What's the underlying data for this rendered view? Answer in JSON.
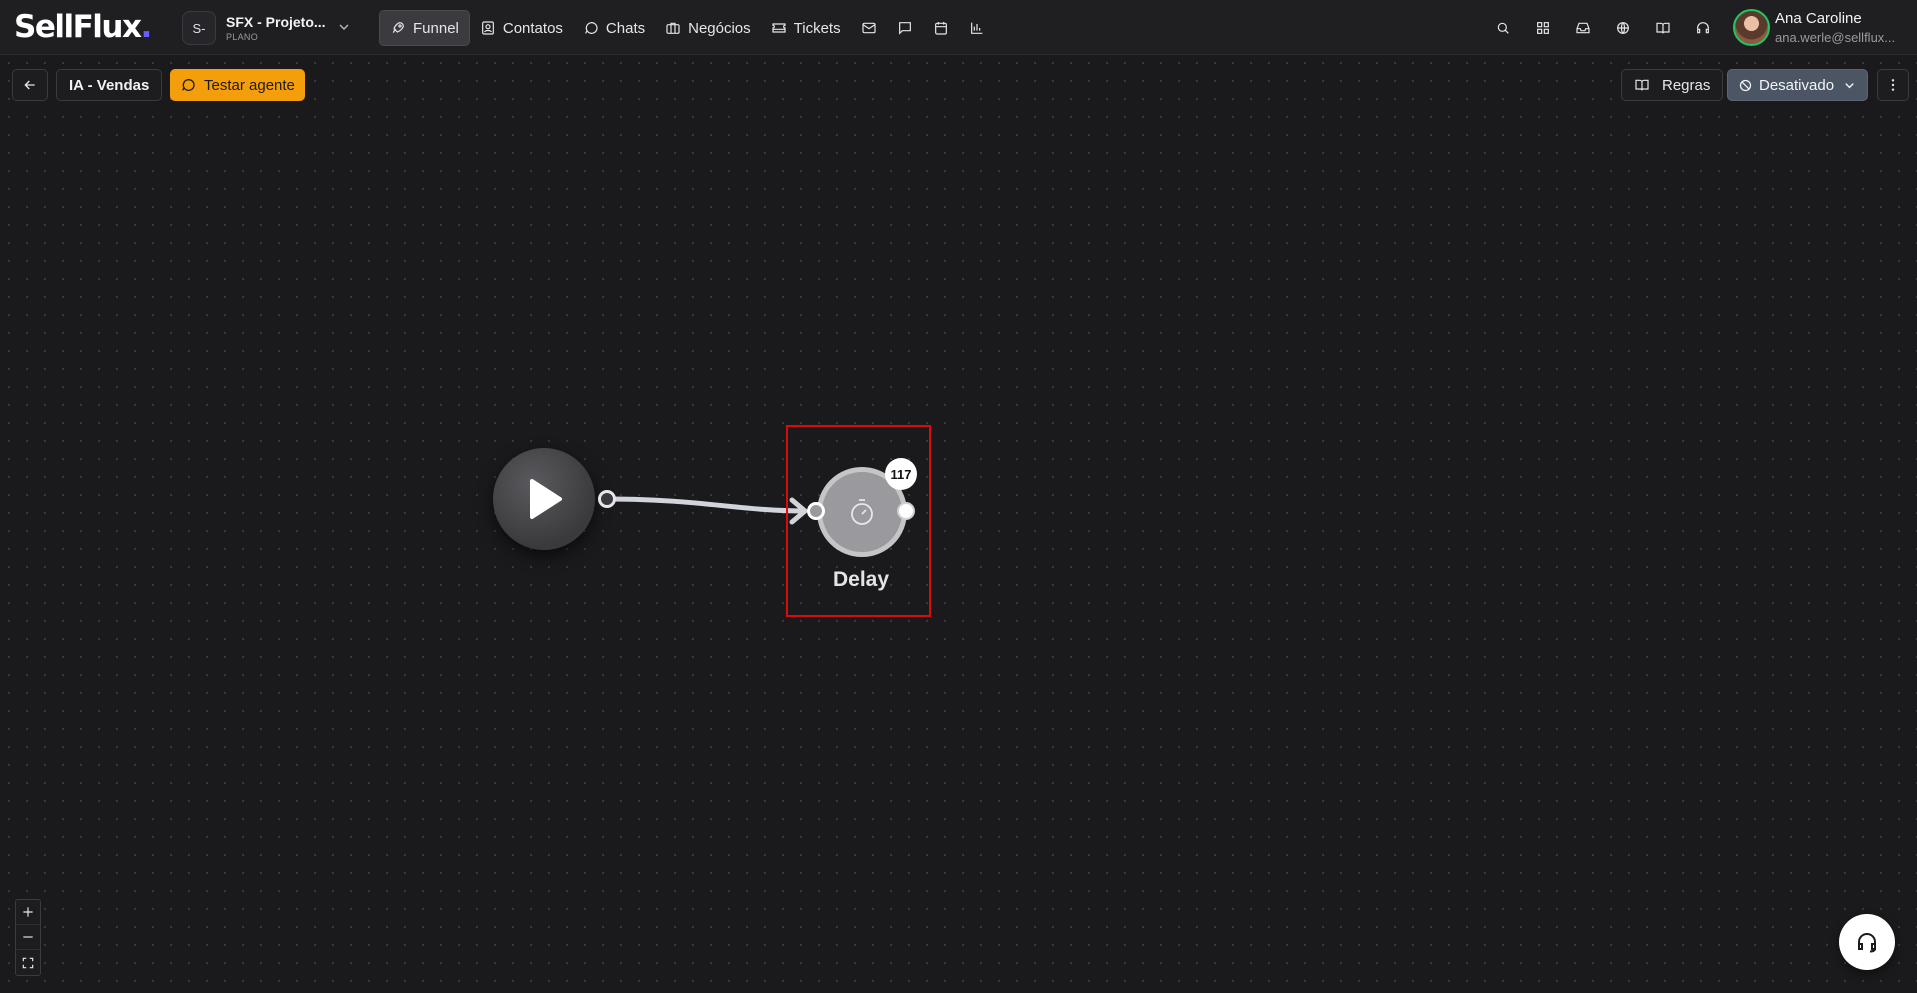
{
  "app": {
    "logo_text": "SellFlux",
    "brand_accent": "#6d5cff"
  },
  "project": {
    "badge": "S-",
    "name": "SFX - Projeto...",
    "plan": "PLANO"
  },
  "nav": {
    "items": [
      {
        "label": "Funnel",
        "icon": "rocket-icon",
        "active": true
      },
      {
        "label": "Contatos",
        "icon": "contact-icon"
      },
      {
        "label": "Chats",
        "icon": "chat-icon"
      },
      {
        "label": "Negócios",
        "icon": "briefcase-icon"
      },
      {
        "label": "Tickets",
        "icon": "ticket-icon"
      }
    ],
    "icon_items": [
      "mail-icon",
      "message-square-icon",
      "calendar-icon",
      "bar-chart-icon"
    ],
    "right_icons": [
      "search-icon",
      "apps-grid-icon",
      "inbox-icon",
      "globe-icon",
      "book-icon",
      "headset-icon"
    ]
  },
  "user": {
    "name": "Ana Caroline",
    "email": "ana.werle@sellflux..."
  },
  "toolbar": {
    "flow_name": "IA - Vendas",
    "test_label": "Testar agente",
    "rules_label": "Regras",
    "status_label": "Desativado",
    "test_color": "#f59e0b",
    "status_color": "#4b5563"
  },
  "canvas": {
    "start_node": {
      "icon": "play-icon"
    },
    "delay_node": {
      "label": "Delay",
      "count": "117",
      "icon": "stopwatch-icon",
      "highlight_color": "#d90b0b"
    }
  },
  "zoom_controls": [
    "zoom-in-icon",
    "zoom-out-icon",
    "fit-view-icon"
  ],
  "help": {
    "icon": "headset-icon"
  }
}
